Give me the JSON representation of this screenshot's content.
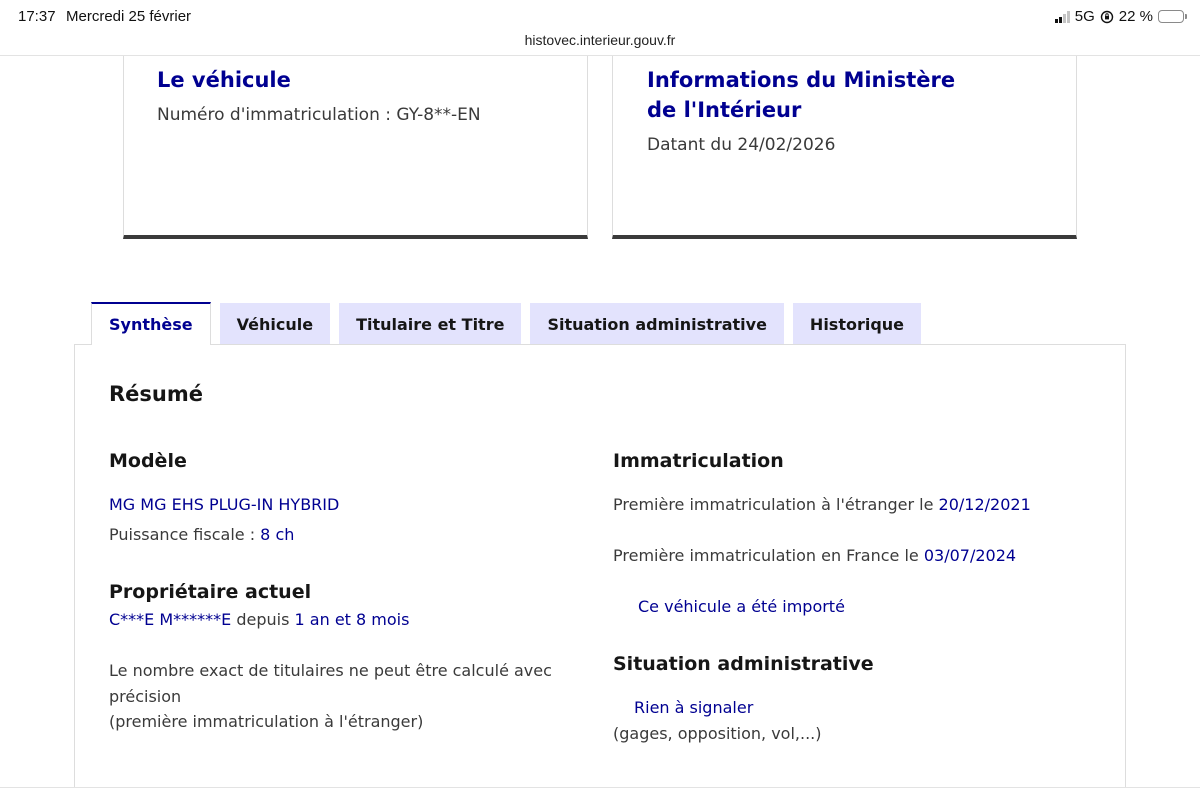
{
  "status_bar": {
    "time": "17:37",
    "date": "Mercredi 25 février",
    "url": "histovec.interieur.gouv.fr",
    "network": "5G",
    "battery": "22 %",
    "battery_level": 0.22
  },
  "cards": {
    "vehicle": {
      "title": "Le véhicule",
      "text": "Numéro d'immatriculation : GY-8**-EN"
    },
    "ministry": {
      "title": "Informations du Ministère de l'Intérieur",
      "text": "Datant du 24/02/2026"
    }
  },
  "tabs": [
    {
      "label": "Synthèse",
      "active": true
    },
    {
      "label": "Véhicule",
      "active": false
    },
    {
      "label": "Titulaire et Titre",
      "active": false
    },
    {
      "label": "Situation administrative",
      "active": false
    },
    {
      "label": "Historique",
      "active": false
    }
  ],
  "summary": {
    "heading": "Résumé",
    "model": {
      "heading": "Modèle",
      "name": "MG MG EHS PLUG-IN HYBRID",
      "power_label": "Puissance fiscale : ",
      "power_value": "8 ch"
    },
    "owner": {
      "heading": "Propriétaire actuel",
      "name": "C***E M******E",
      "since_label": " depuis ",
      "duration": "1 an et 8 mois",
      "note_line1": "Le nombre exact de titulaires ne peut être calculé avec précision",
      "note_line2": "(première immatriculation à l'étranger)"
    },
    "registration": {
      "heading": "Immatriculation",
      "foreign_label": "Première immatriculation à l'étranger le ",
      "foreign_date": "20/12/2021",
      "france_label": "Première immatriculation en France le ",
      "france_date": "03/07/2024",
      "imported_note": "Ce véhicule a été importé"
    },
    "admin": {
      "heading": "Situation administrative",
      "status": "Rien à signaler",
      "details": "(gages, opposition, vol,...)"
    }
  }
}
